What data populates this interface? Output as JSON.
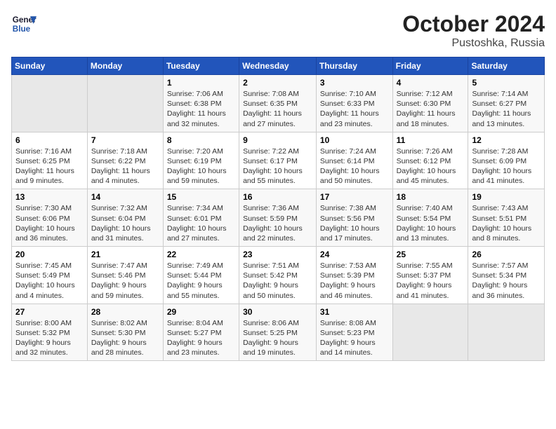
{
  "header": {
    "logo_line1": "General",
    "logo_line2": "Blue",
    "month": "October 2024",
    "location": "Pustoshka, Russia"
  },
  "weekdays": [
    "Sunday",
    "Monday",
    "Tuesday",
    "Wednesday",
    "Thursday",
    "Friday",
    "Saturday"
  ],
  "weeks": [
    [
      {
        "day": "",
        "info": ""
      },
      {
        "day": "",
        "info": ""
      },
      {
        "day": "1",
        "info": "Sunrise: 7:06 AM\nSunset: 6:38 PM\nDaylight: 11 hours and 32 minutes."
      },
      {
        "day": "2",
        "info": "Sunrise: 7:08 AM\nSunset: 6:35 PM\nDaylight: 11 hours and 27 minutes."
      },
      {
        "day": "3",
        "info": "Sunrise: 7:10 AM\nSunset: 6:33 PM\nDaylight: 11 hours and 23 minutes."
      },
      {
        "day": "4",
        "info": "Sunrise: 7:12 AM\nSunset: 6:30 PM\nDaylight: 11 hours and 18 minutes."
      },
      {
        "day": "5",
        "info": "Sunrise: 7:14 AM\nSunset: 6:27 PM\nDaylight: 11 hours and 13 minutes."
      }
    ],
    [
      {
        "day": "6",
        "info": "Sunrise: 7:16 AM\nSunset: 6:25 PM\nDaylight: 11 hours and 9 minutes."
      },
      {
        "day": "7",
        "info": "Sunrise: 7:18 AM\nSunset: 6:22 PM\nDaylight: 11 hours and 4 minutes."
      },
      {
        "day": "8",
        "info": "Sunrise: 7:20 AM\nSunset: 6:19 PM\nDaylight: 10 hours and 59 minutes."
      },
      {
        "day": "9",
        "info": "Sunrise: 7:22 AM\nSunset: 6:17 PM\nDaylight: 10 hours and 55 minutes."
      },
      {
        "day": "10",
        "info": "Sunrise: 7:24 AM\nSunset: 6:14 PM\nDaylight: 10 hours and 50 minutes."
      },
      {
        "day": "11",
        "info": "Sunrise: 7:26 AM\nSunset: 6:12 PM\nDaylight: 10 hours and 45 minutes."
      },
      {
        "day": "12",
        "info": "Sunrise: 7:28 AM\nSunset: 6:09 PM\nDaylight: 10 hours and 41 minutes."
      }
    ],
    [
      {
        "day": "13",
        "info": "Sunrise: 7:30 AM\nSunset: 6:06 PM\nDaylight: 10 hours and 36 minutes."
      },
      {
        "day": "14",
        "info": "Sunrise: 7:32 AM\nSunset: 6:04 PM\nDaylight: 10 hours and 31 minutes."
      },
      {
        "day": "15",
        "info": "Sunrise: 7:34 AM\nSunset: 6:01 PM\nDaylight: 10 hours and 27 minutes."
      },
      {
        "day": "16",
        "info": "Sunrise: 7:36 AM\nSunset: 5:59 PM\nDaylight: 10 hours and 22 minutes."
      },
      {
        "day": "17",
        "info": "Sunrise: 7:38 AM\nSunset: 5:56 PM\nDaylight: 10 hours and 17 minutes."
      },
      {
        "day": "18",
        "info": "Sunrise: 7:40 AM\nSunset: 5:54 PM\nDaylight: 10 hours and 13 minutes."
      },
      {
        "day": "19",
        "info": "Sunrise: 7:43 AM\nSunset: 5:51 PM\nDaylight: 10 hours and 8 minutes."
      }
    ],
    [
      {
        "day": "20",
        "info": "Sunrise: 7:45 AM\nSunset: 5:49 PM\nDaylight: 10 hours and 4 minutes."
      },
      {
        "day": "21",
        "info": "Sunrise: 7:47 AM\nSunset: 5:46 PM\nDaylight: 9 hours and 59 minutes."
      },
      {
        "day": "22",
        "info": "Sunrise: 7:49 AM\nSunset: 5:44 PM\nDaylight: 9 hours and 55 minutes."
      },
      {
        "day": "23",
        "info": "Sunrise: 7:51 AM\nSunset: 5:42 PM\nDaylight: 9 hours and 50 minutes."
      },
      {
        "day": "24",
        "info": "Sunrise: 7:53 AM\nSunset: 5:39 PM\nDaylight: 9 hours and 46 minutes."
      },
      {
        "day": "25",
        "info": "Sunrise: 7:55 AM\nSunset: 5:37 PM\nDaylight: 9 hours and 41 minutes."
      },
      {
        "day": "26",
        "info": "Sunrise: 7:57 AM\nSunset: 5:34 PM\nDaylight: 9 hours and 36 minutes."
      }
    ],
    [
      {
        "day": "27",
        "info": "Sunrise: 8:00 AM\nSunset: 5:32 PM\nDaylight: 9 hours and 32 minutes."
      },
      {
        "day": "28",
        "info": "Sunrise: 8:02 AM\nSunset: 5:30 PM\nDaylight: 9 hours and 28 minutes."
      },
      {
        "day": "29",
        "info": "Sunrise: 8:04 AM\nSunset: 5:27 PM\nDaylight: 9 hours and 23 minutes."
      },
      {
        "day": "30",
        "info": "Sunrise: 8:06 AM\nSunset: 5:25 PM\nDaylight: 9 hours and 19 minutes."
      },
      {
        "day": "31",
        "info": "Sunrise: 8:08 AM\nSunset: 5:23 PM\nDaylight: 9 hours and 14 minutes."
      },
      {
        "day": "",
        "info": ""
      },
      {
        "day": "",
        "info": ""
      }
    ]
  ]
}
